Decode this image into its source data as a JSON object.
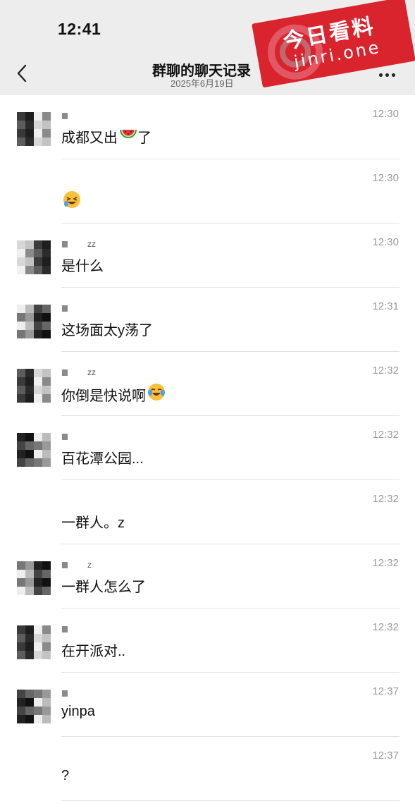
{
  "status_bar": {
    "time": "12:41"
  },
  "header": {
    "title": "群聊的聊天记录",
    "date": "2025年6月19日",
    "back_icon": "chevron-left-icon",
    "more_icon": "ellipsis-icon"
  },
  "watermark": {
    "title": "今日看料",
    "subtitle": "jinri.one"
  },
  "colors": {
    "background": "#ffffff",
    "header_bg": "#ededed",
    "divider": "#e3e3e3",
    "time_text": "#9a9a9a",
    "watermark_red": "#d9232d"
  },
  "messages": [
    {
      "time": "12:30",
      "text": "成都又出",
      "emoji": "watermelon-icon",
      "suffix": "了",
      "nick_suffix": ""
    },
    {
      "time": "12:30",
      "text": "",
      "emoji": "laughing-emoji-icon",
      "suffix": "",
      "nick_suffix": ""
    },
    {
      "time": "12:30",
      "text": "是什么",
      "emoji": "",
      "suffix": "",
      "nick_suffix": "zz"
    },
    {
      "time": "12:31",
      "text": "这场面太y荡了",
      "emoji": "",
      "suffix": "",
      "nick_suffix": ""
    },
    {
      "time": "12:32",
      "text": "你倒是快说啊",
      "emoji": "tears-of-joy-icon",
      "suffix": "",
      "nick_suffix": "zz"
    },
    {
      "time": "12:32",
      "text": "百花潭公园...",
      "emoji": "",
      "suffix": "",
      "nick_suffix": ""
    },
    {
      "time": "12:32",
      "text": "一群人。z",
      "emoji": "",
      "suffix": "",
      "nick_suffix": ""
    },
    {
      "time": "12:32",
      "text": "一群人怎么了",
      "emoji": "",
      "suffix": "",
      "nick_suffix": "z"
    },
    {
      "time": "12:32",
      "text": "在开派对..",
      "emoji": "",
      "suffix": "",
      "nick_suffix": ""
    },
    {
      "time": "12:37",
      "text": "yinpa",
      "emoji": "",
      "suffix": "",
      "nick_suffix": ""
    },
    {
      "time": "12:37",
      "text": "?",
      "emoji": "",
      "suffix": "",
      "nick_suffix": ""
    }
  ]
}
